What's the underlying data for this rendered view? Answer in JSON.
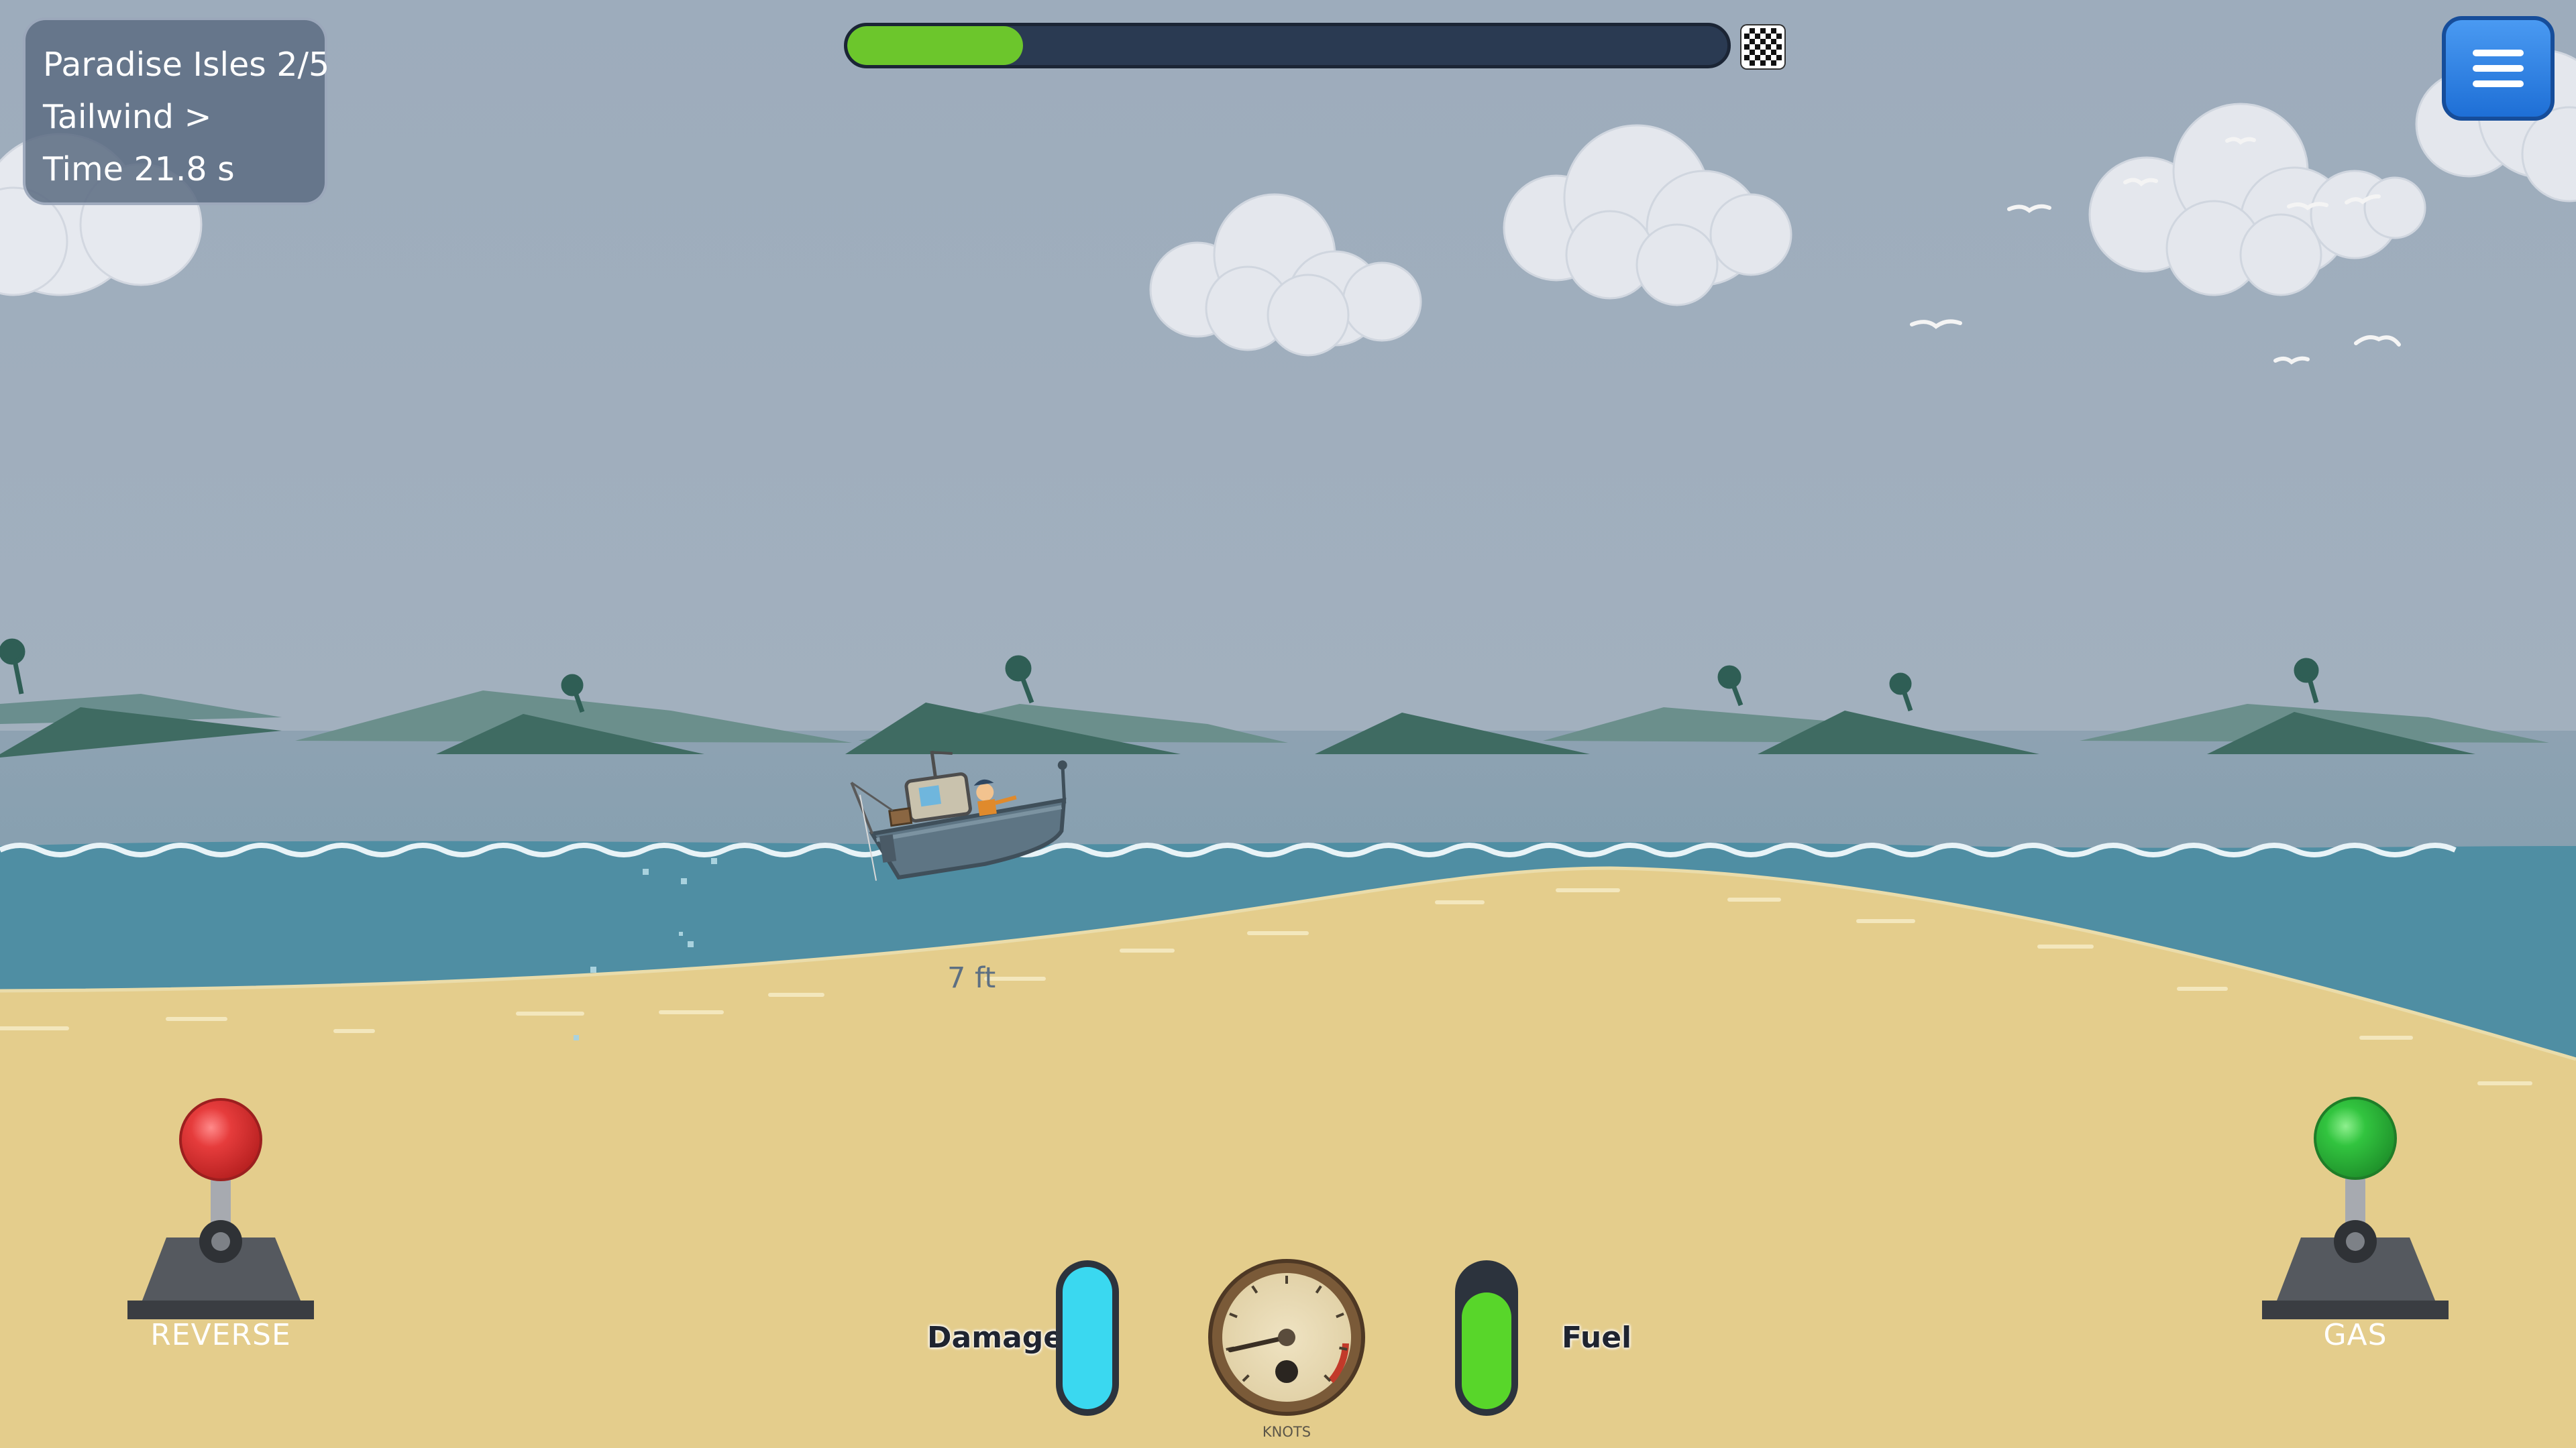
{
  "hud": {
    "level": "Paradise Isles 2/5",
    "wind": "Tailwind >",
    "time": "Time 21.8 s"
  },
  "progress": {
    "fraction": 0.2
  },
  "menu": {
    "icon": "hamburger-menu-icon"
  },
  "boat": {
    "depth_label": "7 ft"
  },
  "controls": {
    "reverse_label": "REVERSE",
    "gas_label": "GAS"
  },
  "gauges": {
    "damage_label": "Damage",
    "damage_level": 1.0,
    "fuel_label": "Fuel",
    "fuel_level": 0.82,
    "speed_unit": "KNOTS",
    "speed_needle_fraction": 0.12
  },
  "colors": {
    "sky": "#9aa9b9",
    "sea": "#4f8ea3",
    "sand": "#e3cd8c",
    "progress": "#6cc62c",
    "damage": "#3ad8f0",
    "fuel": "#58d62a",
    "reverse_knob": "#e03a3a",
    "gas_knob": "#2fbf3f",
    "menu": "#2f7fe0"
  }
}
